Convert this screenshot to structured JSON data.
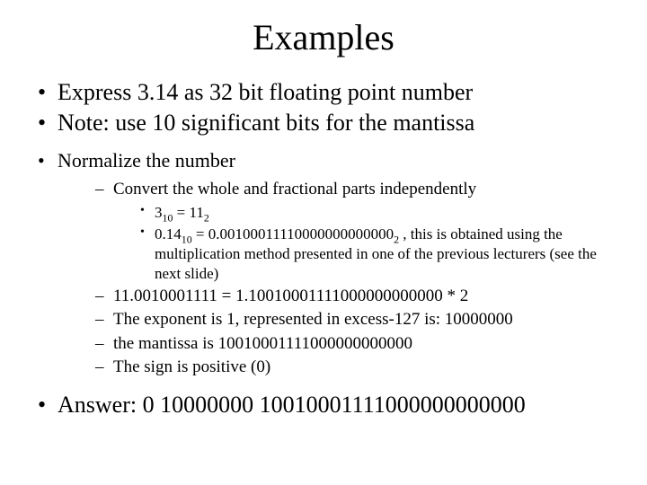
{
  "title": "Examples",
  "bullets": {
    "b1": "Express 3.14 as 32 bit floating point number",
    "b2": "Note: use 10 significant bits for the mantissa",
    "b3": "Normalize the number",
    "answer": "Answer: 0 10000000 10010001111000000000000"
  },
  "lvl2": {
    "d1": "Convert the whole and fractional parts independently",
    "d2": "11.0010001111 = 1.10010001111000000000000 * 2",
    "d3": "The exponent is 1, represented in excess-127 is: 10000000",
    "d4": "the mantissa is 10010001111000000000000",
    "d5": "The sign is positive (0)"
  },
  "lvl3": {
    "c1": {
      "a": "3",
      "sub1": "10",
      "eq": " = 11",
      "sub2": "2"
    },
    "c2": {
      "a": "0.14",
      "sub1": "10",
      "eq": " = 0.00100011110000000000000",
      "sub2": "2",
      "tail": " , this is obtained using the multiplication method presented in one of the previous lecturers (see the next slide)"
    }
  }
}
